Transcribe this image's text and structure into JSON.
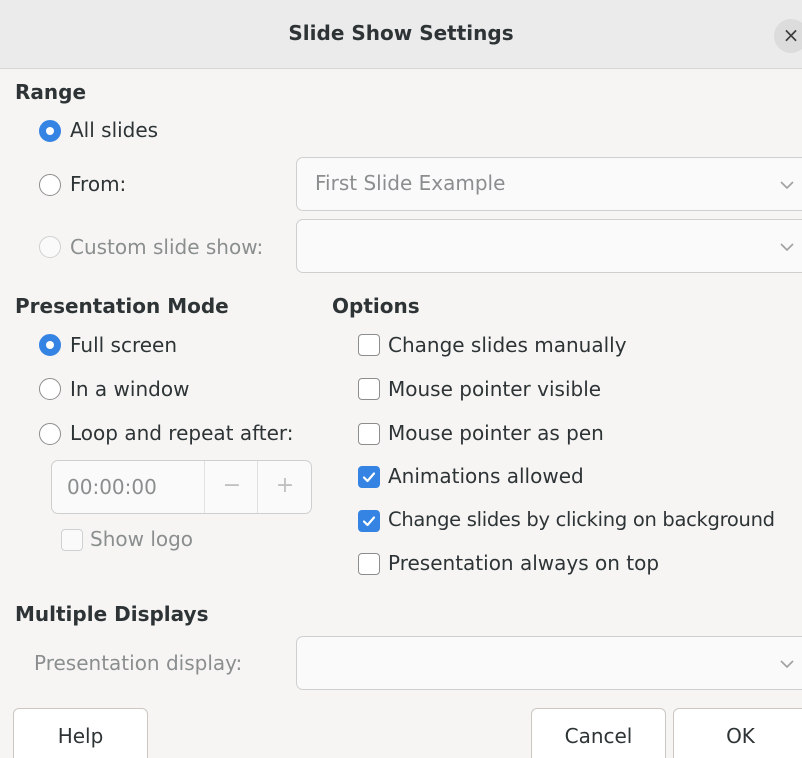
{
  "dialog": {
    "title": "Slide Show Settings",
    "close_glyph": "×"
  },
  "range": {
    "heading": "Range",
    "all_slides_label": "All slides",
    "all_slides_selected": true,
    "from_label": "From:",
    "from_selected": false,
    "from_value": "First Slide Example",
    "custom_label": "Custom slide show:",
    "custom_selected": false,
    "custom_value": ""
  },
  "presentation_mode": {
    "heading": "Presentation Mode",
    "full_screen_label": "Full screen",
    "full_screen_selected": true,
    "window_label": "In a window",
    "window_selected": false,
    "loop_label": "Loop and repeat after:",
    "loop_selected": false,
    "loop_time": "00:00:00",
    "minus_glyph": "−",
    "plus_glyph": "+",
    "show_logo_label": "Show logo",
    "show_logo_checked": false
  },
  "options": {
    "heading": "Options",
    "items": [
      {
        "label": "Change slides manually",
        "checked": false
      },
      {
        "label": "Mouse pointer visible",
        "checked": false
      },
      {
        "label": "Mouse pointer as pen",
        "checked": false
      },
      {
        "label": "Animations allowed",
        "checked": true
      },
      {
        "label": "Change slides by clicking on background",
        "checked": true
      },
      {
        "label": "Presentation always on top",
        "checked": false
      }
    ]
  },
  "multiple_displays": {
    "heading": "Multiple Displays",
    "display_label": "Presentation display:",
    "display_value": ""
  },
  "buttons": {
    "help": "Help",
    "cancel": "Cancel",
    "ok": "OK"
  },
  "icons": {
    "close": "close-icon",
    "chevron": "chevron-down-icon",
    "checkmark": "checkmark-icon"
  },
  "colors": {
    "accent": "#3584e4",
    "disabled_text": "#8b8e8f",
    "text": "#2e3436",
    "background": "#f6f5f4"
  }
}
